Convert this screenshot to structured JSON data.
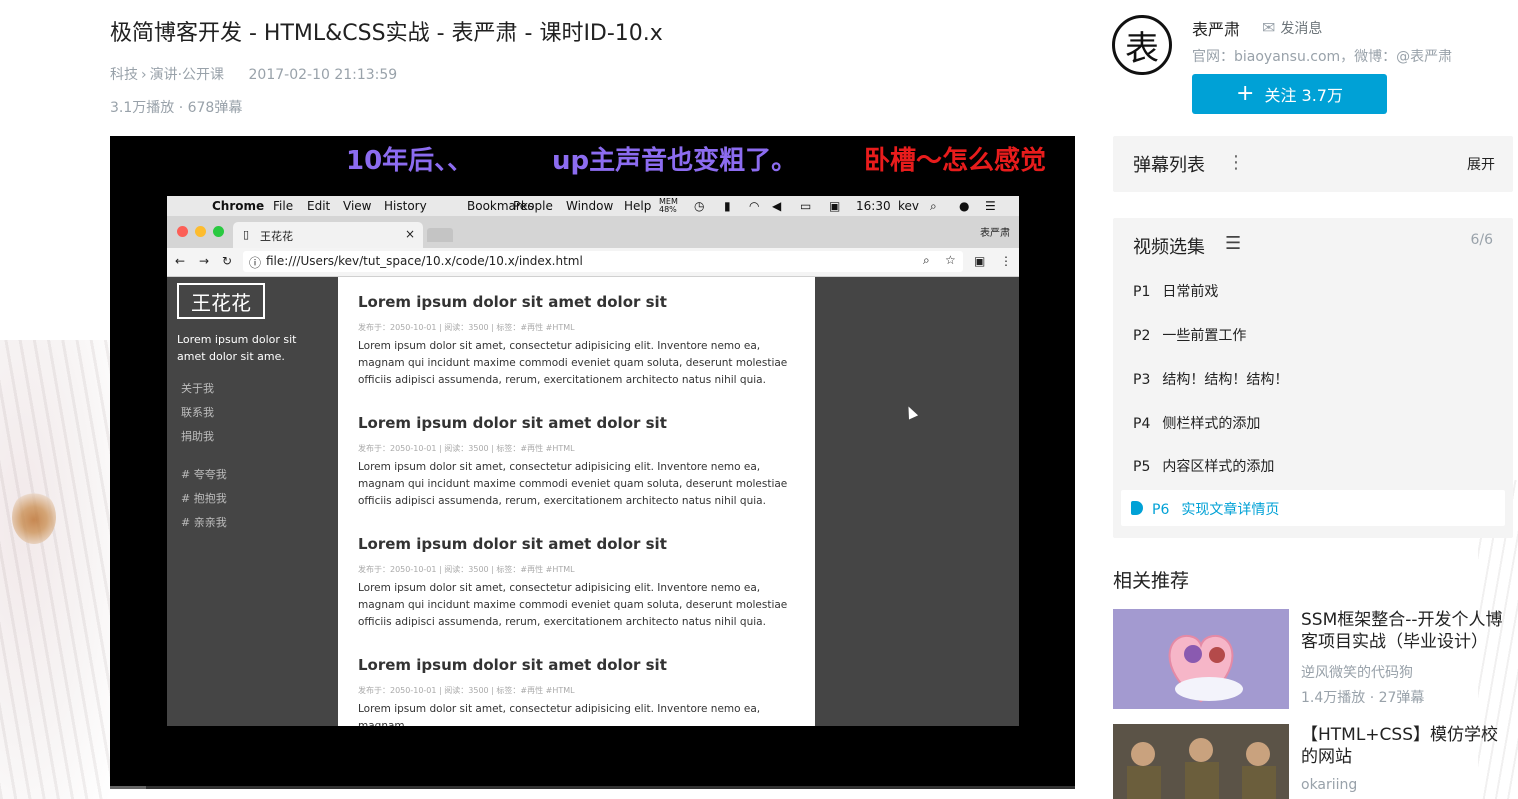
{
  "video": {
    "title": "极简博客开发 - HTML&CSS实战 - 表严肃 - 课时ID-10.x",
    "category": "科技",
    "subcategory": "演讲·公开课",
    "category_sep": "›",
    "publish_time": "2017-02-10 21:13:59",
    "stats": "3.1万播放 · 678弹幕"
  },
  "player": {
    "danmaku": [
      {
        "text": "10年后、、",
        "color": "#8c6cf0"
      },
      {
        "text": "up主声音也变粗了。",
        "color": "#8c6cf0"
      },
      {
        "text": "卧槽～怎么感觉",
        "color": "#e81c1c"
      }
    ],
    "screen": {
      "apple_icon": "",
      "menu": [
        "Chrome",
        "File",
        "Edit",
        "View",
        "History",
        "Bookmarks",
        "People",
        "Window",
        "Help"
      ],
      "mem": "MEM 48%",
      "clock": "16:30",
      "user": "kev",
      "tab_title": "王花花",
      "tab_close": "×",
      "profile_name": "表严肃",
      "url": "file:///Users/kev/tut_space/10.x/code/10.x/index.html",
      "site": {
        "logo": "王花花",
        "desc": "Lorem ipsum dolor sit amet dolor sit ame.",
        "links": [
          "关于我",
          "联系我",
          "捐助我"
        ],
        "tags": [
          "# 夸夸我",
          "# 抱抱我",
          "# 亲亲我"
        ],
        "posts": [
          {
            "title": "Lorem ipsum dolor sit amet dolor sit",
            "meta": "发布于：2050-10-01 | 阅读：3500 | 标签：#再性 #HTML",
            "body": "Lorem ipsum dolor sit amet, consectetur adipisicing elit. Inventore nemo ea, magnam qui incidunt maxime commodi eveniet quam soluta, deserunt molestiae officiis adipisci assumenda, rerum, exercitationem architecto natus nihil quia."
          },
          {
            "title": "Lorem ipsum dolor sit amet dolor sit",
            "meta": "发布于：2050-10-01 | 阅读：3500 | 标签：#再性 #HTML",
            "body": "Lorem ipsum dolor sit amet, consectetur adipisicing elit. Inventore nemo ea, magnam qui incidunt maxime commodi eveniet quam soluta, deserunt molestiae officiis adipisci assumenda, rerum, exercitationem architecto natus nihil quia."
          },
          {
            "title": "Lorem ipsum dolor sit amet dolor sit",
            "meta": "发布于：2050-10-01 | 阅读：3500 | 标签：#再性 #HTML",
            "body": "Lorem ipsum dolor sit amet, consectetur adipisicing elit. Inventore nemo ea, magnam qui incidunt maxime commodi eveniet quam soluta, deserunt molestiae officiis adipisci assumenda, rerum, exercitationem architecto natus nihil quia."
          },
          {
            "title": "Lorem ipsum dolor sit amet dolor sit",
            "meta": "发布于：2050-10-01 | 阅读：3500 | 标签：#再性 #HTML",
            "body": "Lorem ipsum dolor sit amet, consectetur adipisicing elit. Inventore nemo ea, magnam"
          }
        ]
      }
    }
  },
  "uploader": {
    "avatar_glyph": "表",
    "name": "表严肃",
    "message_label": "发消息",
    "sign": "官网：biaoyansu.com，微博：@表严肃",
    "follow_label": "关注 3.7万",
    "follow_plus": "+"
  },
  "danmaku_panel": {
    "title": "弹幕列表",
    "kebab": "⋮",
    "expand": "展开"
  },
  "episodes": {
    "title": "视频选集",
    "count": "6/6",
    "items": [
      {
        "no": "P1",
        "title": "日常前戏"
      },
      {
        "no": "P2",
        "title": "一些前置工作"
      },
      {
        "no": "P3",
        "title": "结构！结构！结构！"
      },
      {
        "no": "P4",
        "title": "侧栏样式的添加"
      },
      {
        "no": "P5",
        "title": "内容区样式的添加"
      }
    ],
    "active": {
      "no": "P6",
      "title": "实现文章详情页"
    }
  },
  "related": {
    "title": "相关推荐",
    "items": [
      {
        "title": "SSM框架整合--开发个人博客项目实战（毕业设计）",
        "author": "逆风微笑的代码狗",
        "stats": "1.4万播放 · 27弹幕"
      },
      {
        "title": "【HTML+CSS】模仿学校的网站",
        "author": "okariing",
        "stats": ""
      }
    ]
  },
  "colors": {
    "accent": "#00a1d6",
    "meta_gray": "#99a2aa"
  }
}
